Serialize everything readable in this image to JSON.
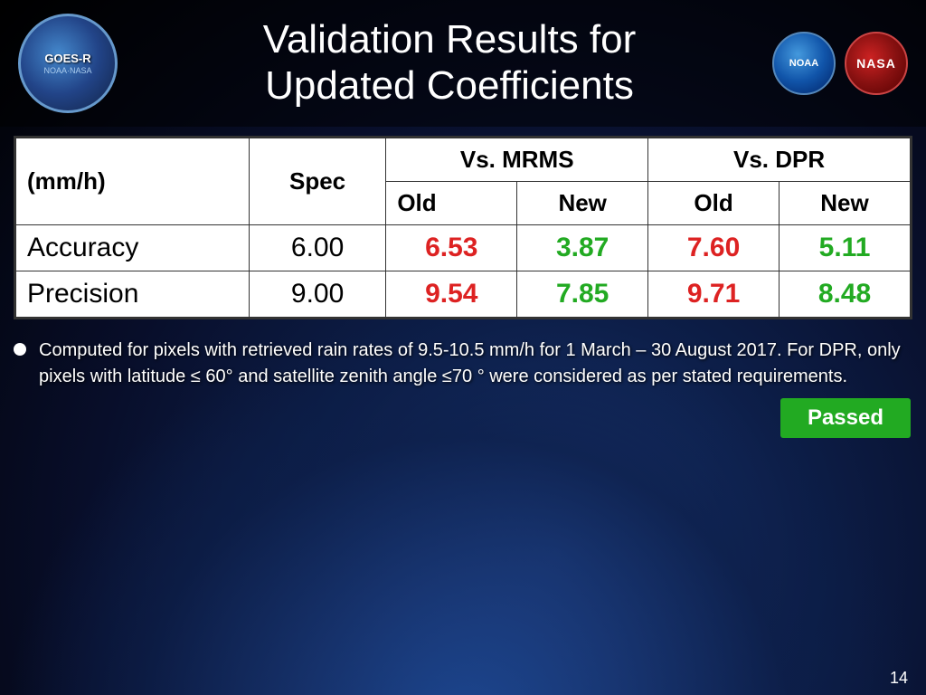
{
  "page": {
    "number": "14"
  },
  "header": {
    "title_line1": "Validation Results for",
    "title_line2": "Updated Coefficients",
    "goes_logo": {
      "line1": "GOES-R",
      "line2": "NOAA · NASA"
    },
    "noaa_label": "NOAA",
    "nasa_label": "NASA"
  },
  "table": {
    "unit_header": "(mm/h)",
    "spec_header": "Spec",
    "vs_mrms_header": "Vs. MRMS",
    "vs_dpr_header": "Vs. DPR",
    "old_label": "Old",
    "new_label": "New",
    "old_label2": "Old",
    "new_label2": "New",
    "rows": [
      {
        "label": "Accuracy",
        "spec": "6.00",
        "mrms_old": "6.53",
        "mrms_old_color": "red",
        "mrms_new": "3.87",
        "mrms_new_color": "green",
        "dpr_old": "7.60",
        "dpr_old_color": "red",
        "dpr_new": "5.11",
        "dpr_new_color": "green"
      },
      {
        "label": "Precision",
        "spec": "9.00",
        "mrms_old": "9.54",
        "mrms_old_color": "red",
        "mrms_new": "7.85",
        "mrms_new_color": "green",
        "dpr_old": "9.71",
        "dpr_old_color": "red",
        "dpr_new": "8.48",
        "dpr_new_color": "green"
      }
    ]
  },
  "bullet": {
    "text": "Computed for pixels with retrieved rain rates of 9.5-10.5 mm/h for 1 March – 30 August 2017. For DPR, only pixels with latitude ≤ 60° and satellite zenith angle ≤70 ° were considered as per stated requirements."
  },
  "passed_badge": {
    "label": "Passed"
  }
}
